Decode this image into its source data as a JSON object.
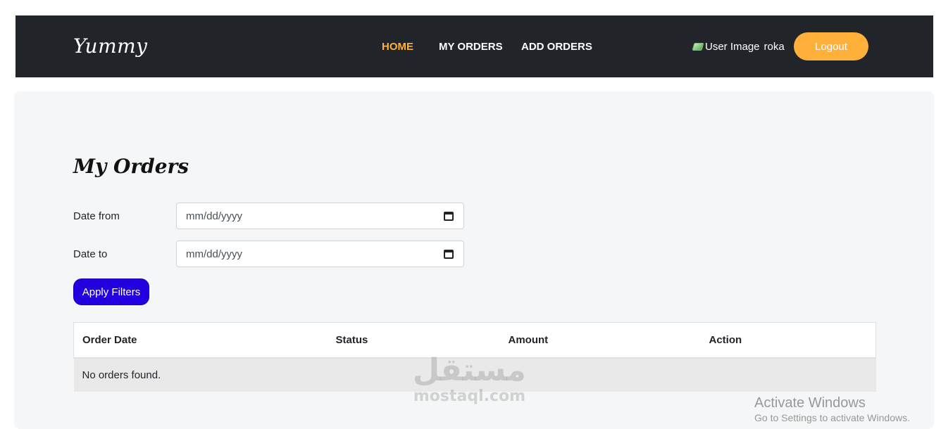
{
  "navbar": {
    "brand": "Yummy",
    "links": [
      "HOME",
      "MY ORDERS",
      "ADD ORDERS"
    ],
    "active_link": "HOME",
    "user_image_alt": "User Image",
    "username": "roka",
    "logout_label": "Logout"
  },
  "page": {
    "title": "My Orders",
    "date_from_label": "Date from",
    "date_from_placeholder": "mm/dd/yyyy",
    "date_to_label": "Date to",
    "date_to_placeholder": "mm/dd/yyyy",
    "apply_label": "Apply Filters"
  },
  "table": {
    "headers": [
      "Order Date",
      "Status",
      "Amount",
      "Action"
    ],
    "empty_message": "No orders found."
  },
  "watermark": {
    "arabic": "مستقل",
    "latin": "mostaql.com"
  },
  "os_notice": {
    "title": "Activate Windows",
    "subtitle": "Go to Settings to activate Windows."
  },
  "colors": {
    "navbar_bg": "#212529",
    "accent": "#ffb03b",
    "apply_button": "#2200e0"
  }
}
